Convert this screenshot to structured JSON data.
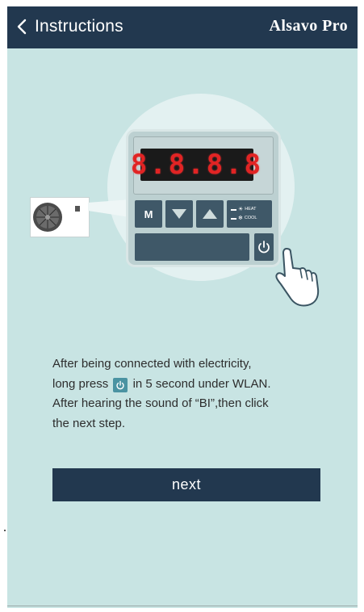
{
  "header": {
    "back_label": "Instructions",
    "app_title": "Alsavo Pro",
    "background_color": "#22384f"
  },
  "illustration": {
    "display_digits": "8.8.8.8",
    "mode_button_label": "M",
    "mode_heat_label": "HEAT",
    "mode_cool_label": "COOL",
    "icons": [
      "outdoor-unit-fan-icon",
      "arrow-down-icon",
      "arrow-up-icon",
      "sun-icon",
      "snowflake-icon",
      "power-icon",
      "pointing-hand-icon"
    ]
  },
  "instructions": {
    "line1": "After being connected with electricity,",
    "line2_before": "long press",
    "line2_after": "in 5 second under WLAN.",
    "line3": "After hearing the sound of “BI”,then click",
    "line4": "the next step."
  },
  "actions": {
    "next_label": "next"
  },
  "colors": {
    "screen_background": "#c8e4e3",
    "accent_dark": "#22384f",
    "power_icon_bg": "#4a93a2",
    "digit_red": "#e12424"
  }
}
